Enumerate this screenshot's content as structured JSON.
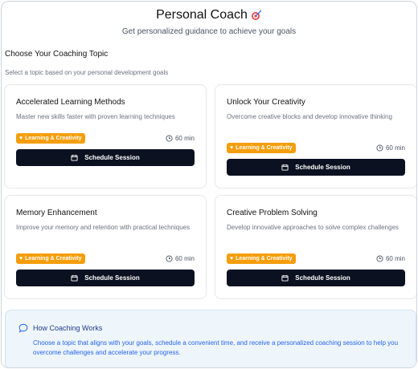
{
  "header": {
    "title": "Personal Coach",
    "subtitle": "Get personalized guidance to achieve your goals"
  },
  "section": {
    "title": "Choose Your Coaching Topic",
    "subtitle": "Select a topic based on your personal development goals"
  },
  "cards": [
    {
      "title": "Accelerated Learning Methods",
      "description": "Master new skills faster with proven learning techniques",
      "badge": "Learning & Creativity",
      "duration": "60 min",
      "button": "Schedule Session"
    },
    {
      "title": "Unlock Your Creativity",
      "description": "Overcome creative blocks and develop innovative thinking",
      "badge": "Learning & Creativity",
      "duration": "60 min",
      "button": "Schedule Session"
    },
    {
      "title": "Memory Enhancement",
      "description": "Improve your memory and retention with practical techniques",
      "badge": "Learning & Creativity",
      "duration": "60 min",
      "button": "Schedule Session"
    },
    {
      "title": "Creative Problem Solving",
      "description": "Develop innovative approaches to solve complex challenges",
      "badge": "Learning & Creativity",
      "duration": "60 min",
      "button": "Schedule Session"
    }
  ],
  "info": {
    "title": "How Coaching Works",
    "text": "Choose a topic that aligns with your goals, schedule a convenient time, and receive a personalized coaching session to help you overcome challenges and accelerate your progress."
  },
  "colors": {
    "badge": "#f59e0b",
    "button": "#0b1120",
    "info_bg": "#eef6fc",
    "info_text": "#2563eb"
  },
  "icons": {
    "title": "target-icon",
    "badge": "heart-icon",
    "duration": "clock-icon",
    "button": "calendar-icon",
    "info": "chat-bubble-icon"
  }
}
